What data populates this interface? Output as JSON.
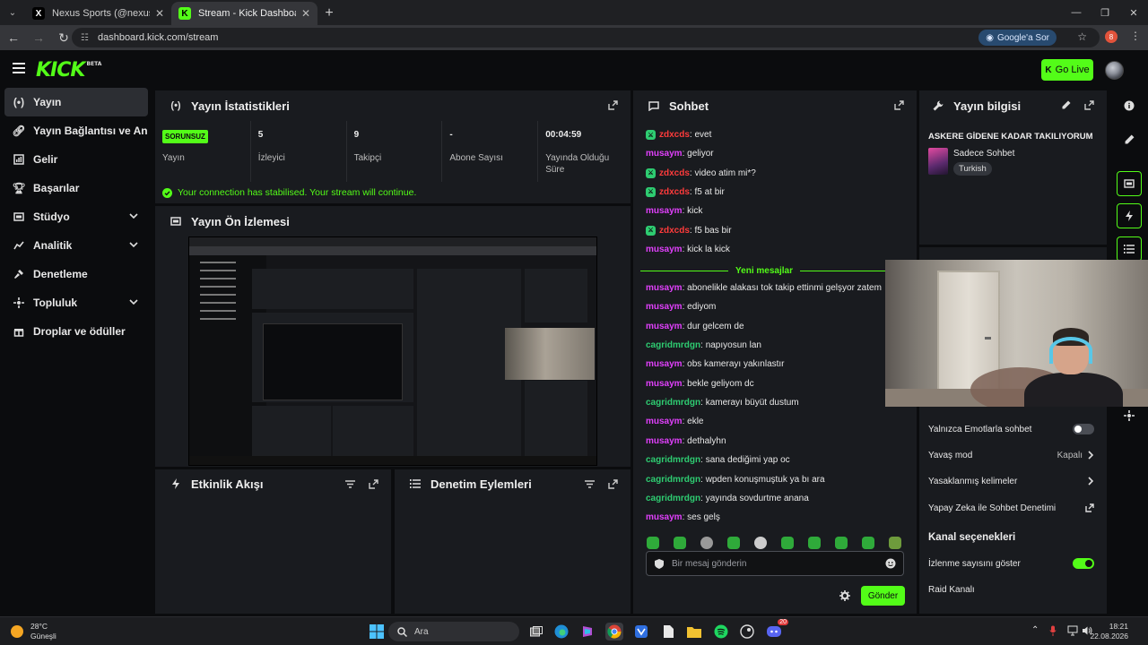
{
  "browser": {
    "tabs": [
      {
        "title": "Nexus Sports (@nexustransfer)",
        "icon": "x-logo",
        "active": false
      },
      {
        "title": "Stream - Kick Dashboard",
        "icon": "kick-logo",
        "active": true
      }
    ],
    "url": "dashboard.kick.com/stream",
    "google_button": "Google'a Sor",
    "profile_initial": "8"
  },
  "header": {
    "logo": "KICK",
    "logo_tag": "BETA",
    "go_live_label": "Go Live"
  },
  "sidebar": {
    "items": [
      {
        "label": "Yayın",
        "icon": "broadcast-icon",
        "active": true,
        "expandable": false
      },
      {
        "label": "Yayın Bağlantısı ve Anahtar",
        "icon": "link-icon",
        "active": false,
        "expandable": false
      },
      {
        "label": "Gelir",
        "icon": "revenue-icon",
        "active": false,
        "expandable": false
      },
      {
        "label": "Başarılar",
        "icon": "trophy-icon",
        "active": false,
        "expandable": false
      },
      {
        "label": "Stüdyo",
        "icon": "studio-icon",
        "active": false,
        "expandable": true
      },
      {
        "label": "Analitik",
        "icon": "analytics-icon",
        "active": false,
        "expandable": true
      },
      {
        "label": "Denetleme",
        "icon": "moderation-icon",
        "active": false,
        "expandable": false
      },
      {
        "label": "Topluluk",
        "icon": "community-icon",
        "active": false,
        "expandable": true
      },
      {
        "label": "Droplar ve ödüller",
        "icon": "gift-icon",
        "active": false,
        "expandable": false
      }
    ]
  },
  "stats": {
    "title": "Yayın İstatistikleri",
    "status_badge": "SORUNSUZ",
    "items": [
      {
        "value": "",
        "label": "Yayın"
      },
      {
        "value": "5",
        "label": "İzleyici"
      },
      {
        "value": "9",
        "label": "Takipçi"
      },
      {
        "value": "-",
        "label": "Abone Sayısı"
      },
      {
        "value": "00:04:59",
        "label": "Yayında Olduğu Süre"
      }
    ],
    "notice": "Your connection has stabilised. Your stream will continue."
  },
  "preview": {
    "title": "Yayın Ön İzlemesi"
  },
  "activity": {
    "title": "Etkinlik Akışı"
  },
  "moderation": {
    "title": "Denetim Eylemleri"
  },
  "chat": {
    "title": "Sohbet",
    "messages_before": [
      {
        "user": "zdxcds",
        "text": "evet",
        "color": "#ff3b3b",
        "mod": true
      },
      {
        "user": "musaym",
        "text": "geliyor",
        "color": "#e040fb",
        "mod": false
      },
      {
        "user": "zdxcds",
        "text": "video atim mi*?",
        "color": "#ff3b3b",
        "mod": true
      },
      {
        "user": "zdxcds",
        "text": "f5 at bir",
        "color": "#ff3b3b",
        "mod": true
      },
      {
        "user": "musaym",
        "text": "kick",
        "color": "#e040fb",
        "mod": false
      },
      {
        "user": "zdxcds",
        "text": "f5 bas bir",
        "color": "#ff3b3b",
        "mod": true
      },
      {
        "user": "musaym",
        "text": "kick la kick",
        "color": "#e040fb",
        "mod": false
      }
    ],
    "new_messages_label": "Yeni mesajlar",
    "messages_after": [
      {
        "user": "musaym",
        "text": "abonelikle alakası tok takip ettinmi gelşyor zatem",
        "color": "#e040fb"
      },
      {
        "user": "musaym",
        "text": "ediyom",
        "color": "#e040fb"
      },
      {
        "user": "musaym",
        "text": "dur gelcem de",
        "color": "#e040fb"
      },
      {
        "user": "cagridmrdgn",
        "text": "napıyosun lan",
        "color": "#2ecc71"
      },
      {
        "user": "musaym",
        "text": "obs kamerayı yakınlastır",
        "color": "#e040fb"
      },
      {
        "user": "musaym",
        "text": "bekle geliyom dc",
        "color": "#e040fb"
      },
      {
        "user": "cagridmrdgn",
        "text": "kamerayı büyüt dustum",
        "color": "#2ecc71"
      },
      {
        "user": "musaym",
        "text": "ekle",
        "color": "#e040fb"
      },
      {
        "user": "musaym",
        "text": "dethalyhn",
        "color": "#e040fb"
      },
      {
        "user": "cagridmrdgn",
        "text": "sana dediğimi yap oc",
        "color": "#2ecc71"
      },
      {
        "user": "cagridmrdgn",
        "text": "wpden konuşmuştuk ya bı ara",
        "color": "#2ecc71"
      },
      {
        "user": "cagridmrdgn",
        "text": "yayında sovdurtme anana",
        "color": "#2ecc71"
      },
      {
        "user": "musaym",
        "text": "ses gelş",
        "color": "#e040fb"
      }
    ],
    "input_placeholder": "Bir mesaj gönderin",
    "send_label": "Gönder"
  },
  "stream_info": {
    "title": "Yayın bilgisi",
    "stream_title": "ASKERE GİDENE KADAR TAKILIYORUM",
    "category": "Sadece Sohbet",
    "language": "Turkish"
  },
  "chat_settings": {
    "options": [
      {
        "label": "Yalnızca Emotlarla sohbet",
        "type": "toggle",
        "on": false
      },
      {
        "label": "Yavaş mod",
        "type": "value",
        "value": "Kapalı"
      },
      {
        "label": "Yasaklanmış kelimeler",
        "type": "link"
      },
      {
        "label": "Yapay Zeka ile Sohbet Denetimi",
        "type": "external"
      }
    ],
    "channel_title": "Kanal seçenekleri",
    "channel_options": [
      {
        "label": "İzlenme sayısını göster",
        "type": "toggle",
        "on": true
      },
      {
        "label": "Raid Kanalı",
        "type": "none"
      }
    ]
  },
  "taskbar": {
    "weather_temp": "28°C",
    "weather_desc": "Güneşli",
    "search_label": "Ara",
    "time": "18:21",
    "date": "22.08.2026",
    "discord_badge": "20"
  },
  "colors": {
    "accent": "#53fc18",
    "panel": "#191b1f",
    "background": "#0b0c0e"
  }
}
